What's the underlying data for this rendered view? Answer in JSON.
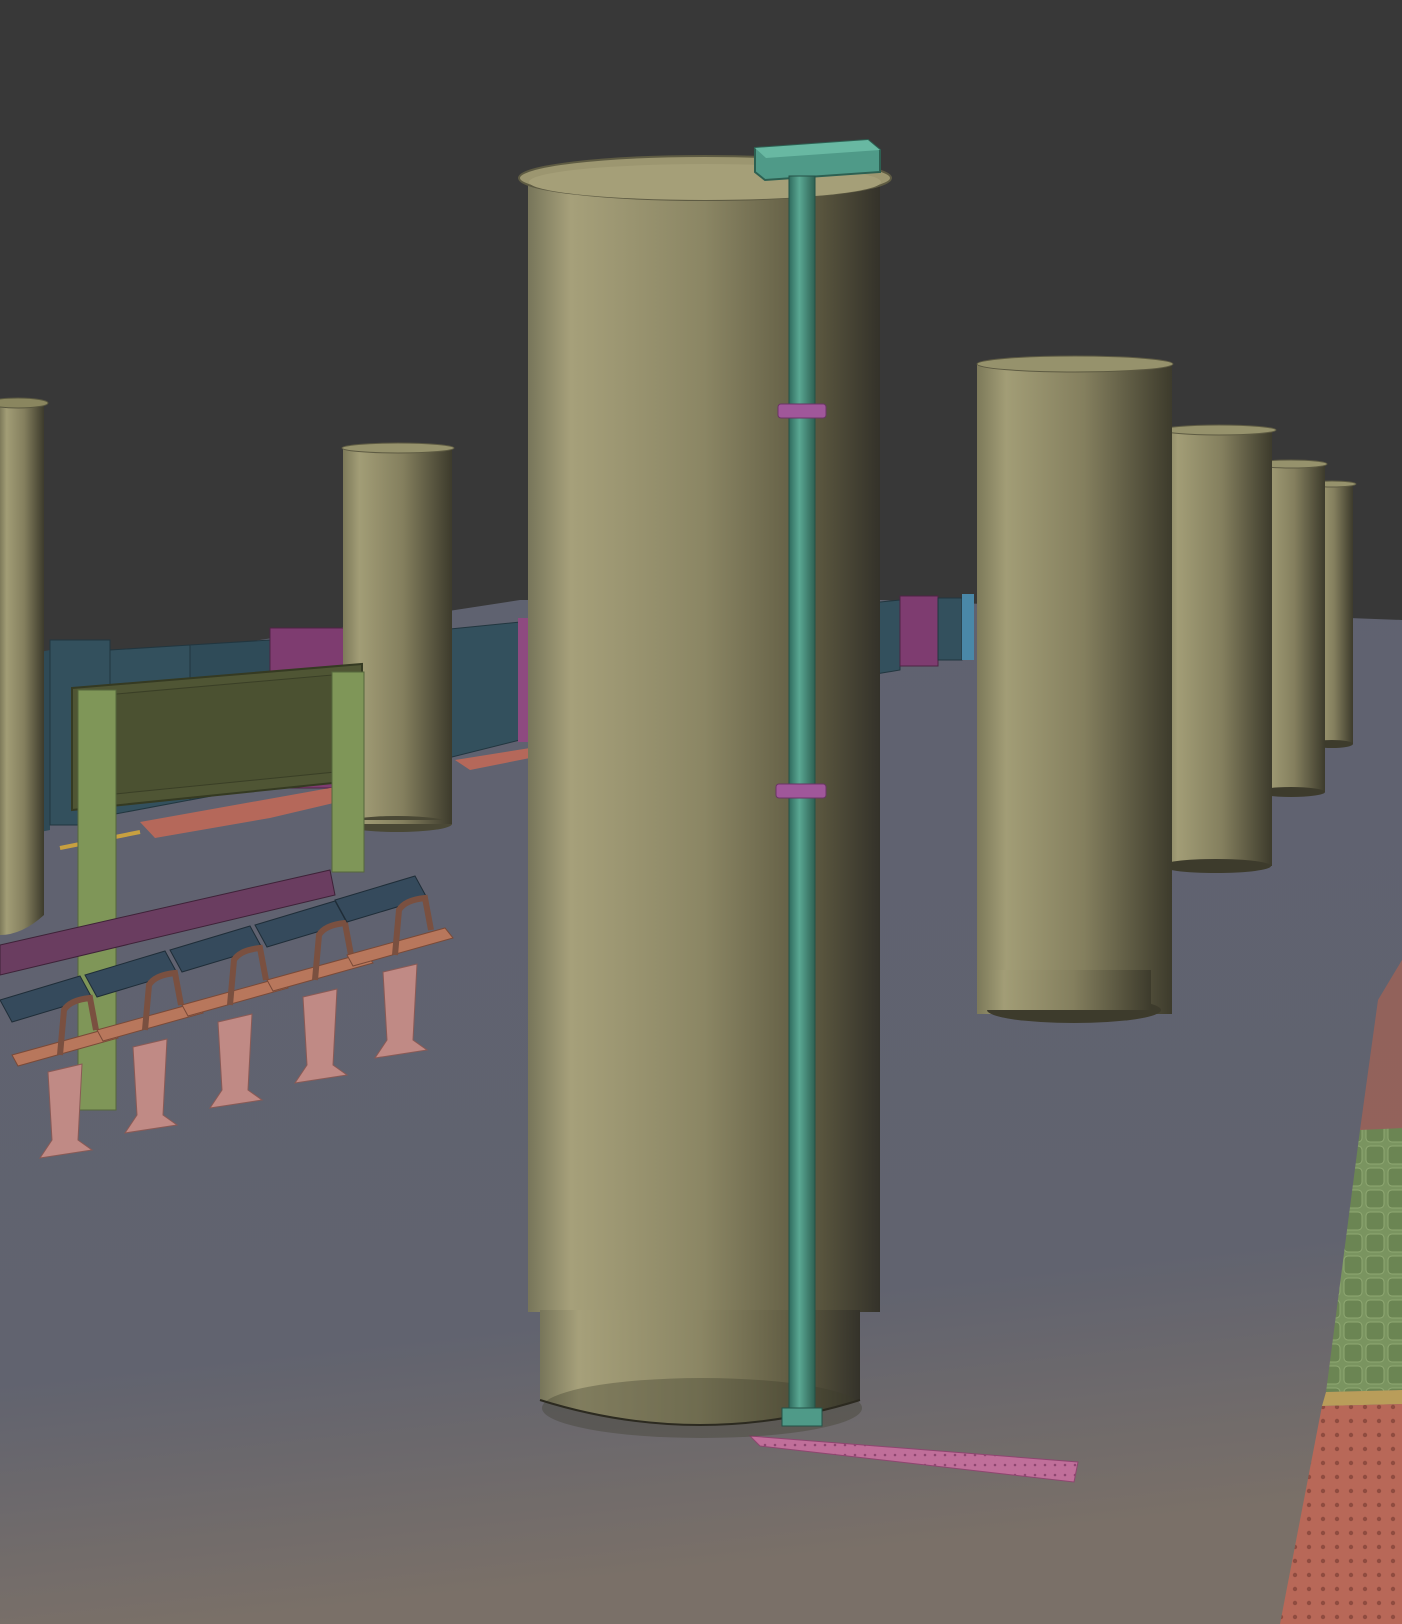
{
  "viewport": {
    "background_color": "#383838",
    "floor_color": "#5f6270",
    "floor_warm_color": "#7a7068"
  },
  "scene": {
    "pillar_color": "#8e8a67",
    "pillar_shadow_color": "#3d3b2c",
    "drain_pipe_color": "#4f9a88",
    "pipe_bracket_color": "#a0579a",
    "floor_plate_color": "#c06f9a",
    "bench_seat_color": "#b8775c",
    "bench_back_color": "#354a5c",
    "bench_leg_color": "#c08a85",
    "sign_color": "#4f5534",
    "sign_post_color": "#7f9658",
    "wall_panel_color": "#33505d",
    "locker_color": "#7e3c70",
    "tactile_orange_color": "#c26a5a",
    "tactile_green_color": "#7a9460"
  }
}
